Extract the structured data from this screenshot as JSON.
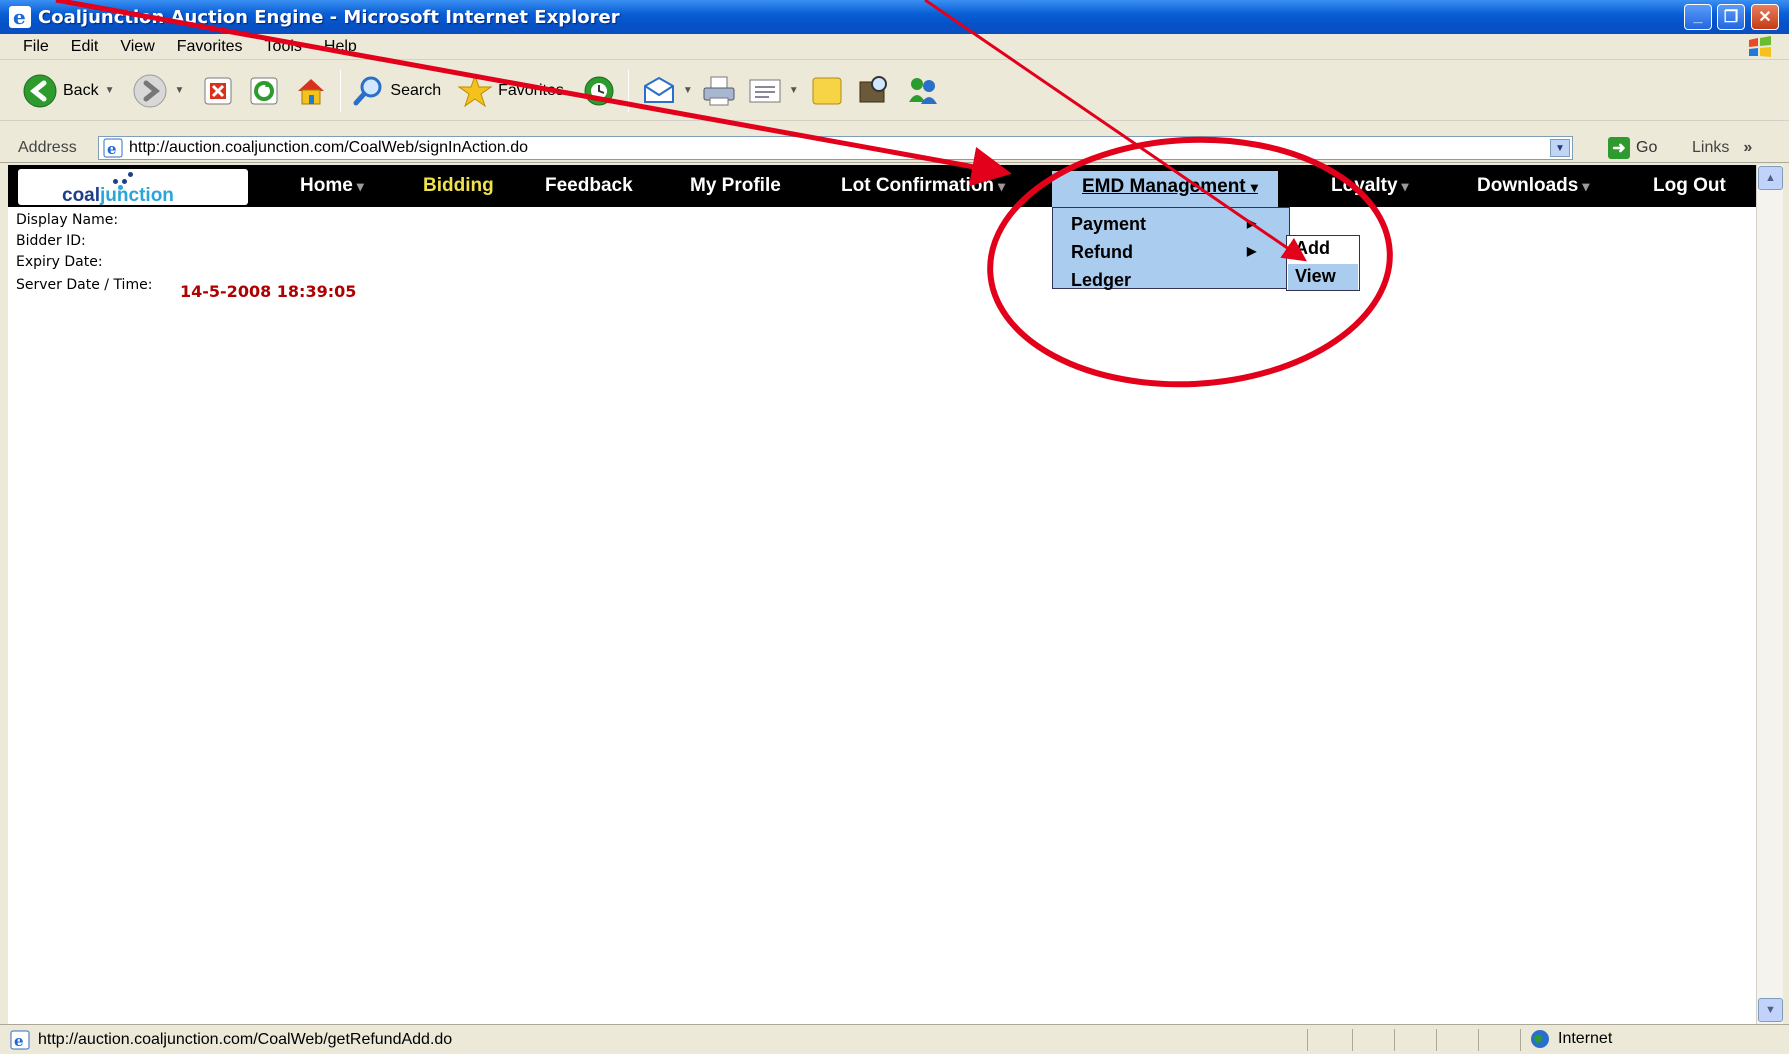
{
  "window": {
    "title": "Coaljunction Auction Engine - Microsoft Internet Explorer",
    "minimize": "_",
    "maximize": "❐",
    "close": "✕"
  },
  "menubar": [
    "File",
    "Edit",
    "View",
    "Favorites",
    "Tools",
    "Help"
  ],
  "toolbar": {
    "back": "Back",
    "search": "Search",
    "favorites": "Favorites"
  },
  "address": {
    "label": "Address",
    "url": "http://auction.coaljunction.com/CoalWeb/signInAction.do",
    "go": "Go",
    "links": "Links",
    "chevron": "»"
  },
  "site": {
    "logo_coal": "coal",
    "logo_junction": "junction",
    "nav": {
      "home": "Home",
      "bidding": "Bidding",
      "feedback": "Feedback",
      "my_profile": "My Profile",
      "lot_confirmation": "Lot Confirmation",
      "emd_management": "EMD Management",
      "loyalty": "Loyalty",
      "downloads": "Downloads",
      "log_out": "Log Out"
    },
    "emd_menu": [
      "Payment",
      "Refund",
      "Ledger"
    ],
    "refund_submenu": [
      "Add",
      "View"
    ],
    "info": {
      "display_name": "Display Name:",
      "bidder_id": "Bidder ID:",
      "expiry_date": "Expiry Date:",
      "server_time_label": "Server Date / Time:",
      "server_time_value": "14-5-2008 18:39:05"
    }
  },
  "status": {
    "url": "http://auction.coaljunction.com/CoalWeb/getRefundAdd.do",
    "zone": "Internet"
  },
  "colors": {
    "annotation": "#e3001b",
    "nav_bg": "#000000",
    "menu_bg": "#aaccee"
  }
}
